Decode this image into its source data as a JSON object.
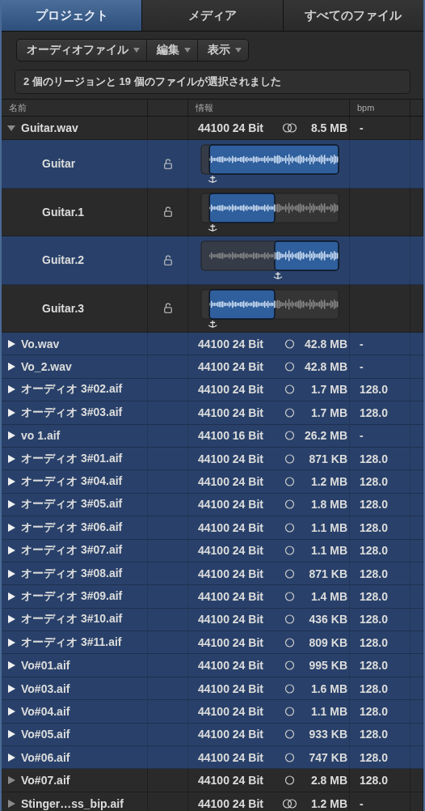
{
  "tabs": [
    {
      "label": "プロジェクト",
      "selected": true
    },
    {
      "label": "メディア",
      "selected": false
    },
    {
      "label": "すべてのファイル",
      "selected": false
    }
  ],
  "menus": [
    {
      "label": "オーディオファイル"
    },
    {
      "label": "編集"
    },
    {
      "label": "表示"
    }
  ],
  "status": "2 個のリージョンと 19 個のファイルが選択されました",
  "columns": [
    "名前",
    "情報",
    "bpm"
  ],
  "files": [
    {
      "name": "Guitar.wav",
      "expanded": true,
      "selected": false,
      "format": "44100 24 Bit",
      "kind": "stereo",
      "size": "8.5 MB",
      "bpm": "-",
      "regions": [
        {
          "name": "Guitar",
          "selected": true,
          "locked": false,
          "kind": "full"
        },
        {
          "name": "Guitar.1",
          "selected": false,
          "locked": false,
          "kind": "start"
        },
        {
          "name": "Guitar.2",
          "selected": true,
          "locked": false,
          "kind": "end"
        },
        {
          "name": "Guitar.3",
          "selected": false,
          "locked": false,
          "kind": "start"
        }
      ]
    },
    {
      "name": "Vo.wav",
      "expanded": false,
      "selected": true,
      "format": "44100 24 Bit",
      "kind": "mono",
      "size": "42.8 MB",
      "bpm": "-"
    },
    {
      "name": "Vo_2.wav",
      "expanded": false,
      "selected": true,
      "format": "44100 24 Bit",
      "kind": "mono",
      "size": "42.8 MB",
      "bpm": "-"
    },
    {
      "name": "オーディオ 3#02.aif",
      "expanded": false,
      "selected": true,
      "format": "44100 24 Bit",
      "kind": "mono",
      "size": "1.7 MB",
      "bpm": "128.0"
    },
    {
      "name": "オーディオ 3#03.aif",
      "expanded": false,
      "selected": true,
      "format": "44100 24 Bit",
      "kind": "mono",
      "size": "1.7 MB",
      "bpm": "128.0"
    },
    {
      "name": "vo 1.aif",
      "expanded": false,
      "selected": true,
      "format": "44100 16 Bit",
      "kind": "mono",
      "size": "26.2 MB",
      "bpm": "-"
    },
    {
      "name": "オーディオ 3#01.aif",
      "expanded": false,
      "selected": true,
      "format": "44100 24 Bit",
      "kind": "mono",
      "size": "871 KB",
      "bpm": "128.0"
    },
    {
      "name": "オーディオ 3#04.aif",
      "expanded": false,
      "selected": true,
      "format": "44100 24 Bit",
      "kind": "mono",
      "size": "1.2 MB",
      "bpm": "128.0"
    },
    {
      "name": "オーディオ 3#05.aif",
      "expanded": false,
      "selected": true,
      "format": "44100 24 Bit",
      "kind": "mono",
      "size": "1.8 MB",
      "bpm": "128.0"
    },
    {
      "name": "オーディオ 3#06.aif",
      "expanded": false,
      "selected": true,
      "format": "44100 24 Bit",
      "kind": "mono",
      "size": "1.1 MB",
      "bpm": "128.0"
    },
    {
      "name": "オーディオ 3#07.aif",
      "expanded": false,
      "selected": true,
      "format": "44100 24 Bit",
      "kind": "mono",
      "size": "1.1 MB",
      "bpm": "128.0"
    },
    {
      "name": "オーディオ 3#08.aif",
      "expanded": false,
      "selected": true,
      "format": "44100 24 Bit",
      "kind": "mono",
      "size": "871 KB",
      "bpm": "128.0"
    },
    {
      "name": "オーディオ 3#09.aif",
      "expanded": false,
      "selected": true,
      "format": "44100 24 Bit",
      "kind": "mono",
      "size": "1.4 MB",
      "bpm": "128.0"
    },
    {
      "name": "オーディオ 3#10.aif",
      "expanded": false,
      "selected": true,
      "format": "44100 24 Bit",
      "kind": "mono",
      "size": "436 KB",
      "bpm": "128.0"
    },
    {
      "name": "オーディオ 3#11.aif",
      "expanded": false,
      "selected": true,
      "format": "44100 24 Bit",
      "kind": "mono",
      "size": "809 KB",
      "bpm": "128.0"
    },
    {
      "name": "Vo#01.aif",
      "expanded": false,
      "selected": true,
      "format": "44100 24 Bit",
      "kind": "mono",
      "size": "995 KB",
      "bpm": "128.0"
    },
    {
      "name": "Vo#03.aif",
      "expanded": false,
      "selected": true,
      "format": "44100 24 Bit",
      "kind": "mono",
      "size": "1.6 MB",
      "bpm": "128.0"
    },
    {
      "name": "Vo#04.aif",
      "expanded": false,
      "selected": true,
      "format": "44100 24 Bit",
      "kind": "mono",
      "size": "1.1 MB",
      "bpm": "128.0"
    },
    {
      "name": "Vo#05.aif",
      "expanded": false,
      "selected": true,
      "format": "44100 24 Bit",
      "kind": "mono",
      "size": "933 KB",
      "bpm": "128.0"
    },
    {
      "name": "Vo#06.aif",
      "expanded": false,
      "selected": true,
      "format": "44100 24 Bit",
      "kind": "mono",
      "size": "747 KB",
      "bpm": "128.0"
    },
    {
      "name": "Vo#07.aif",
      "expanded": false,
      "selected": false,
      "format": "44100 24 Bit",
      "kind": "mono",
      "size": "2.8 MB",
      "bpm": "128.0"
    },
    {
      "name": "Stinger…ss_bip.aif",
      "expanded": false,
      "selected": false,
      "format": "44100 24 Bit",
      "kind": "stereo",
      "size": "1.2 MB",
      "bpm": "-"
    }
  ]
}
